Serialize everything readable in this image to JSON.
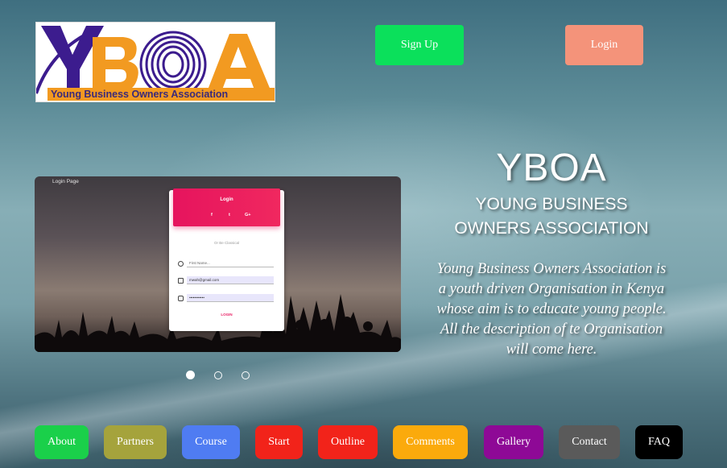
{
  "logo": {
    "letters": "YBOA",
    "caption": "Young Business Owners Association",
    "colors": {
      "purple": "#3c1c8e",
      "orange": "#f29a21"
    }
  },
  "header": {
    "signup_label": "Sign Up",
    "login_label": "Login",
    "colors": {
      "signup": "#0be05b",
      "login": "#f4937a"
    }
  },
  "carousel": {
    "slide_caption": "Login Page",
    "login_form": {
      "title": "Login",
      "social_icons": [
        "facebook-icon",
        "twitter-icon",
        "google-plus-icon"
      ],
      "social_glyphs": [
        "f",
        "t",
        "G+"
      ],
      "divider_text": "Or Be Classical",
      "fields": [
        {
          "icon": "user-icon",
          "value": "First Name..."
        },
        {
          "icon": "email-icon",
          "value": "mwah@gmail.com"
        },
        {
          "icon": "lock-icon",
          "value": "••••••••••••"
        }
      ],
      "submit_label": "LOGIN",
      "accent": "#e91e63"
    },
    "slides_total": 3,
    "active_slide": 1
  },
  "intro": {
    "title": "YBOA",
    "subtitle": "YOUNG BUSINESS OWNERS ASSOCIATION",
    "description": "Young Business Owners Association is a youth driven Organisation in Kenya whose aim is to educate young people. All the description of te Organisation will come here."
  },
  "nav": [
    {
      "label": "About",
      "color": "#1ad04a"
    },
    {
      "label": "Partners",
      "color": "#a5a33c"
    },
    {
      "label": "Course",
      "color": "#4f7cf2"
    },
    {
      "label": "Start",
      "color": "#f2231a"
    },
    {
      "label": "Outline",
      "color": "#f2231a"
    },
    {
      "label": "Comments",
      "color": "#fbaa0c"
    },
    {
      "label": "Gallery",
      "color": "#8e0996"
    },
    {
      "label": "Contact",
      "color": "#5a5a5a"
    },
    {
      "label": "FAQ",
      "color": "#000000"
    }
  ]
}
